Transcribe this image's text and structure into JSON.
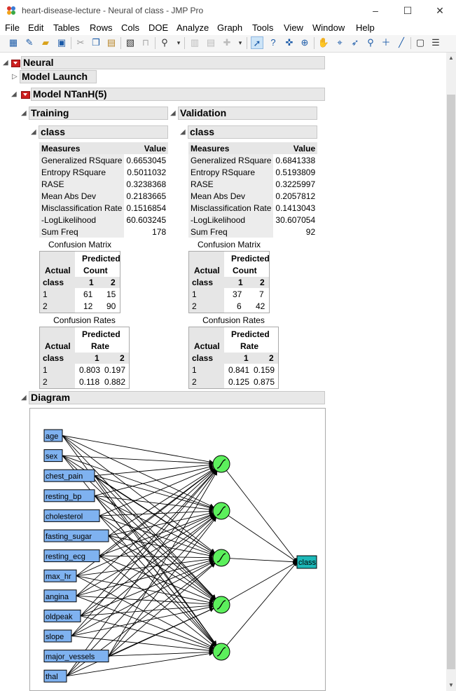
{
  "window": {
    "title": "heart-disease-lecture - Neural of class - JMP Pro",
    "minimize": "–",
    "maximize": "☐",
    "close": "✕"
  },
  "menu": [
    "File",
    "Edit",
    "Tables",
    "Rows",
    "Cols",
    "DOE",
    "Analyze",
    "Graph",
    "Tools",
    "View",
    "Window",
    "Help"
  ],
  "report": {
    "neural_title": "Neural",
    "model_launch_title": "Model Launch",
    "model_title": "Model NTanH(5)",
    "training": {
      "title": "Training",
      "class_title": "class",
      "measures_header": "Measures",
      "value_header": "Value",
      "measures": [
        {
          "name": "Generalized RSquare",
          "value": "0.6653045"
        },
        {
          "name": "Entropy RSquare",
          "value": "0.5011032"
        },
        {
          "name": "RASE",
          "value": "0.3238368"
        },
        {
          "name": "Mean Abs Dev",
          "value": "0.2183665"
        },
        {
          "name": "Misclassification Rate",
          "value": "0.1516854"
        },
        {
          "name": "-LogLikelihood",
          "value": "60.603245"
        },
        {
          "name": "Sum Freq",
          "value": "178"
        }
      ],
      "confusion_matrix": {
        "caption": "Confusion Matrix",
        "predicted": "Predicted",
        "measure": "Count",
        "actual": "Actual",
        "class_label": "class",
        "col1": "1",
        "col2": "2",
        "rows": [
          {
            "label": "1",
            "v1": "61",
            "v2": "15"
          },
          {
            "label": "2",
            "v1": "12",
            "v2": "90"
          }
        ]
      },
      "confusion_rates": {
        "caption": "Confusion Rates",
        "predicted": "Predicted",
        "measure": "Rate",
        "actual": "Actual",
        "class_label": "class",
        "col1": "1",
        "col2": "2",
        "rows": [
          {
            "label": "1",
            "v1": "0.803",
            "v2": "0.197"
          },
          {
            "label": "2",
            "v1": "0.118",
            "v2": "0.882"
          }
        ]
      }
    },
    "validation": {
      "title": "Validation",
      "class_title": "class",
      "measures_header": "Measures",
      "value_header": "Value",
      "measures": [
        {
          "name": "Generalized RSquare",
          "value": "0.6841338"
        },
        {
          "name": "Entropy RSquare",
          "value": "0.5193809"
        },
        {
          "name": "RASE",
          "value": "0.3225997"
        },
        {
          "name": "Mean Abs Dev",
          "value": "0.2057812"
        },
        {
          "name": "Misclassification Rate",
          "value": "0.1413043"
        },
        {
          "name": "-LogLikelihood",
          "value": "30.607054"
        },
        {
          "name": "Sum Freq",
          "value": "92"
        }
      ],
      "confusion_matrix": {
        "caption": "Confusion Matrix",
        "predicted": "Predicted",
        "measure": "Count",
        "actual": "Actual",
        "class_label": "class",
        "col1": "1",
        "col2": "2",
        "rows": [
          {
            "label": "1",
            "v1": "37",
            "v2": "7"
          },
          {
            "label": "2",
            "v1": "6",
            "v2": "42"
          }
        ]
      },
      "confusion_rates": {
        "caption": "Confusion Rates",
        "predicted": "Predicted",
        "measure": "Rate",
        "actual": "Actual",
        "class_label": "class",
        "col1": "1",
        "col2": "2",
        "rows": [
          {
            "label": "1",
            "v1": "0.841",
            "v2": "0.159"
          },
          {
            "label": "2",
            "v1": "0.125",
            "v2": "0.875"
          }
        ]
      }
    },
    "diagram": {
      "title": "Diagram",
      "inputs": [
        "age",
        "sex",
        "chest_pain",
        "resting_bp",
        "cholesterol",
        "fasting_sugar",
        "resting_ecg",
        "max_hr",
        "angina",
        "oldpeak",
        "slope",
        "major_vessels",
        "thal"
      ],
      "hidden_nodes": 5,
      "output": "class",
      "colors": {
        "input": "#7fb2f0",
        "hidden": "#5cf05c",
        "output": "#1cb8b8"
      }
    }
  }
}
